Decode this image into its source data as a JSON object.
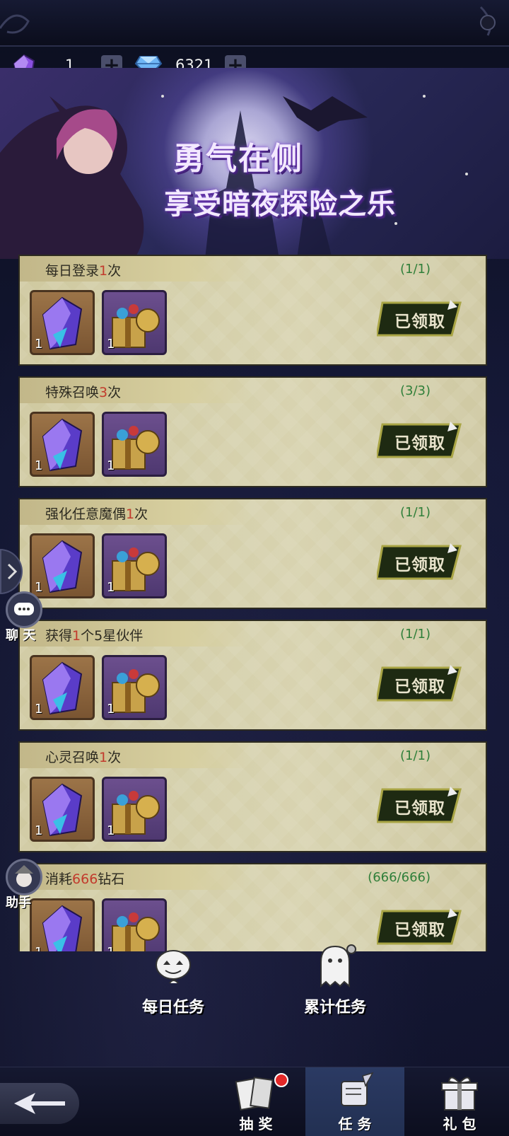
{
  "currency": {
    "crystal_count": "1",
    "diamond_count": "6321"
  },
  "banner": {
    "title_line1": "勇气在侧",
    "title_line2": "享受暗夜探险之乐"
  },
  "tasks": [
    {
      "title_prefix": "每日登录",
      "title_highlight": "1",
      "title_suffix": "次",
      "progress": "(1/1)",
      "reward1_qty": "1",
      "reward2_qty": "1",
      "claim_label": "已领取"
    },
    {
      "title_prefix": "特殊召唤",
      "title_highlight": "3",
      "title_suffix": "次",
      "progress": "(3/3)",
      "reward1_qty": "1",
      "reward2_qty": "1",
      "claim_label": "已领取"
    },
    {
      "title_prefix": "强化任意魔偶",
      "title_highlight": "1",
      "title_suffix": "次",
      "progress": "(1/1)",
      "reward1_qty": "1",
      "reward2_qty": "1",
      "claim_label": "已领取"
    },
    {
      "title_prefix": "获得",
      "title_highlight": "1",
      "title_suffix": "个5星伙伴",
      "progress": "(1/1)",
      "reward1_qty": "1",
      "reward2_qty": "1",
      "claim_label": "已领取"
    },
    {
      "title_prefix": "心灵召唤",
      "title_highlight": "1",
      "title_suffix": "次",
      "progress": "(1/1)",
      "reward1_qty": "1",
      "reward2_qty": "1",
      "claim_label": "已领取"
    },
    {
      "title_prefix": "消耗",
      "title_highlight": "666",
      "title_suffix": "钻石",
      "progress": "(666/666)",
      "reward1_qty": "1",
      "reward2_qty": "1",
      "claim_label": "已领取"
    }
  ],
  "side": {
    "chat_label": "聊 天",
    "assistant_label": "助手"
  },
  "task_tabs": {
    "daily": "每日任务",
    "cumulative": "累计任务"
  },
  "nav": {
    "draw": "抽 奖",
    "tasks": "任 务",
    "gifts": "礼 包"
  },
  "colors": {
    "highlight_red": "#c23a2c",
    "progress_green": "#2f7f3a",
    "card_bg": "#d8d3b0",
    "active_tab": "#2b3a63"
  }
}
